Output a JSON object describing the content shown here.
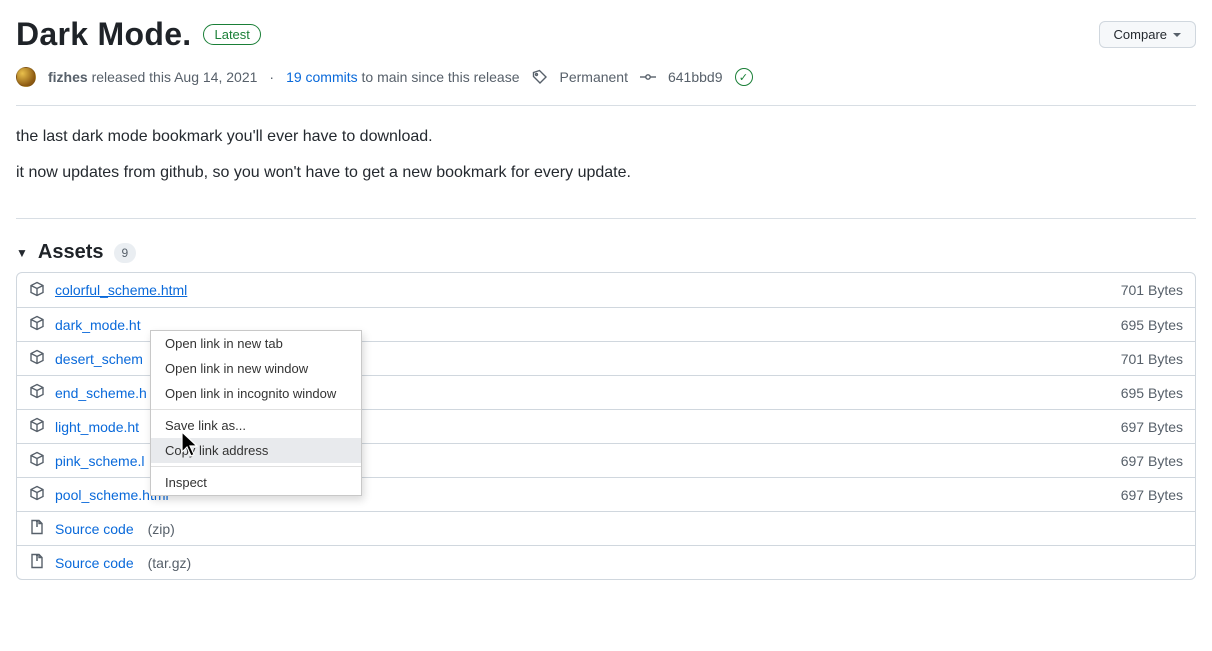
{
  "release": {
    "title": "Dark Mode.",
    "latest_label": "Latest",
    "compare_label": "Compare",
    "author": "fizhes",
    "released_text": "released this",
    "date": "Aug 14, 2021",
    "commits_count": "19 commits",
    "commits_suffix": "to main since this release",
    "tag_label": "Permanent",
    "commit_sha": "641bbd9",
    "desc_line1": "the last dark mode bookmark you'll ever have to download.",
    "desc_line2": "it now updates from github, so you won't have to get a new bookmark for every update."
  },
  "assets": {
    "label": "Assets",
    "count": "9",
    "items": [
      {
        "name": "colorful_scheme.html",
        "display": "colorful_scheme.html",
        "size": "701 Bytes",
        "icon": "cube",
        "underlined": true
      },
      {
        "name": "dark_mode.html",
        "display": "dark_mode.ht",
        "size": "695 Bytes",
        "icon": "cube"
      },
      {
        "name": "desert_scheme.html",
        "display": "desert_schem",
        "size": "701 Bytes",
        "icon": "cube"
      },
      {
        "name": "end_scheme.html",
        "display": "end_scheme.h",
        "size": "695 Bytes",
        "icon": "cube"
      },
      {
        "name": "light_mode.html",
        "display": "light_mode.ht",
        "size": "697 Bytes",
        "icon": "cube"
      },
      {
        "name": "pink_scheme.html",
        "display": "pink_scheme.l",
        "size": "697 Bytes",
        "icon": "cube"
      },
      {
        "name": "pool_scheme.html",
        "display": "pool_scheme.html",
        "size": "697 Bytes",
        "icon": "cube"
      },
      {
        "name": "Source code",
        "display": "Source code",
        "ext": "(zip)",
        "size": "",
        "icon": "zip"
      },
      {
        "name": "Source code",
        "display": "Source code",
        "ext": "(tar.gz)",
        "size": "",
        "icon": "zip"
      }
    ]
  },
  "context_menu": {
    "items": [
      {
        "label": "Open link in new tab"
      },
      {
        "label": "Open link in new window"
      },
      {
        "label": "Open link in incognito window"
      },
      {
        "sep": true
      },
      {
        "label": "Save link as..."
      },
      {
        "label": "Copy link address",
        "highlight": true
      },
      {
        "sep": true
      },
      {
        "label": "Inspect"
      }
    ]
  }
}
